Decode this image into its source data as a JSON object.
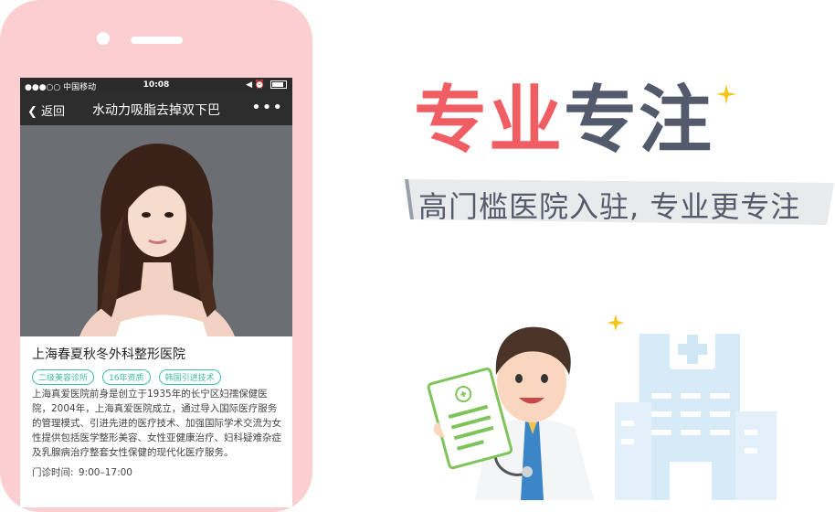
{
  "status_bar": {
    "carrier": "●●●○○ 中国移动",
    "time": "10:08",
    "right": "◀ ⏰"
  },
  "nav": {
    "back_label": "返回",
    "title": "水动力吸脂去掉双下巴",
    "more_label": "•••"
  },
  "hospital": {
    "name": "上海春夏秋冬外科整形医院",
    "tags": [
      "二级美容诊所",
      "16年资质",
      "韩国引进技术"
    ],
    "description": "上海真爱医院前身是创立于1935年的长宁区妇孺保健医院，2004年，上海真爱医院成立，通过导入国际医疗服务的管理模式、引进先进的医疗技术、加强国际学术交流为女性提供包括医学整形美容、女性亚健康治疗、妇科疑难杂症及乳腺病治疗整套女性保健的现代化医疗服务。",
    "hours_label": "门诊时间:",
    "hours_value": "9:00–17:00"
  },
  "promo": {
    "headline_part1": "专业",
    "headline_part2": "专注",
    "subtitle": "高门槛医院入驻, 专业更专注"
  },
  "colors": {
    "phone_body": "#fbcfd2",
    "accent_red": "#f05d63",
    "dark_text": "#525a6c",
    "tag_green": "#3fbfa5",
    "building_blue": "#cfe6f5",
    "star_yellow": "#f5c518"
  }
}
